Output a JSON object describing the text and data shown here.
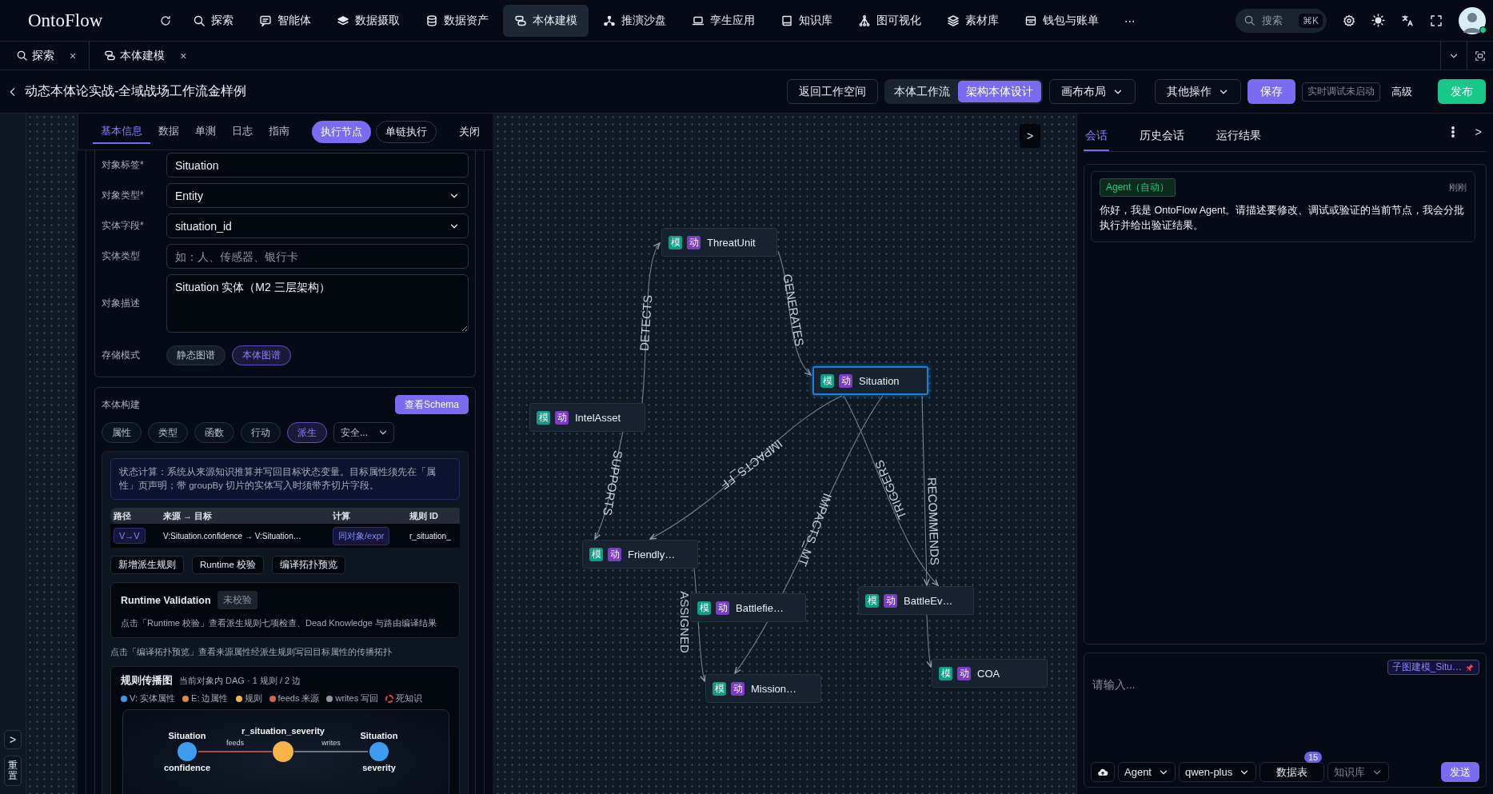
{
  "top_nav": {
    "logo": "OntoFlow",
    "items": [
      {
        "label": "探索",
        "selected": false
      },
      {
        "label": "智能体",
        "selected": false
      },
      {
        "label": "数据摄取",
        "selected": false
      },
      {
        "label": "数据资产",
        "selected": false
      },
      {
        "label": "本体建模",
        "selected": true
      },
      {
        "label": "推演沙盘",
        "selected": false
      },
      {
        "label": "孪生应用",
        "selected": false
      },
      {
        "label": "知识库",
        "selected": false
      },
      {
        "label": "图可视化",
        "selected": false
      },
      {
        "label": "素材库",
        "selected": false
      },
      {
        "label": "钱包与账单",
        "selected": false
      }
    ],
    "more": "⋯",
    "search": {
      "placeholder": "搜索",
      "shortcut": "⌘K"
    }
  },
  "page_tabs": [
    {
      "label": "探索",
      "close": "×"
    },
    {
      "label": "本体建模",
      "close": "×"
    }
  ],
  "header": {
    "title": "动态本体论实战-全域战场工作流金样例",
    "return_button": "返回工作空间",
    "mode_switch": [
      {
        "label": "本体工作流",
        "selected": false
      },
      {
        "label": "架构本体设计",
        "selected": true
      }
    ],
    "layout_menu": "画布布局",
    "more_menu": "其他操作",
    "save": "保存",
    "debug_status": "实时调试未启动",
    "advanced": "高级",
    "publish": "发布"
  },
  "side_strip": {
    "expand": ">",
    "reset": "重置"
  },
  "node_panel": {
    "tabs": [
      {
        "label": "基本信息",
        "selected": true
      },
      {
        "label": "数据",
        "selected": false
      },
      {
        "label": "单测",
        "selected": false
      },
      {
        "label": "日志",
        "selected": false
      },
      {
        "label": "指南",
        "selected": false
      }
    ],
    "run_node": "执行节点",
    "run_chain": "单链执行",
    "close": "关闭",
    "fields": [
      {
        "label": "对象标签*",
        "kind": "input",
        "value": "Situation"
      },
      {
        "label": "对象类型*",
        "kind": "select",
        "value": "Entity"
      },
      {
        "label": "实体字段*",
        "kind": "select",
        "value": "situation_id"
      },
      {
        "label": "实体类型",
        "kind": "input",
        "placeholder": "如：人、传感器、银行卡"
      },
      {
        "label": "对象描述",
        "kind": "textarea",
        "value": "Situation 实体（M2 三层架构）"
      }
    ],
    "storage": {
      "label": "存储模式",
      "options": [
        {
          "label": "静态图谱",
          "selected": false
        },
        {
          "label": "本体图谱",
          "selected": true
        }
      ]
    },
    "build": {
      "title": "本体构建",
      "schema_button": "查看Schema",
      "chips": [
        {
          "label": "属性",
          "selected": false
        },
        {
          "label": "类型",
          "selected": false
        },
        {
          "label": "函数",
          "selected": false
        },
        {
          "label": "行动",
          "selected": false
        },
        {
          "label": "派生",
          "selected": true
        }
      ],
      "chip_select": "安全...",
      "info": "状态计算：系统从来源知识推算并写回目标状态变量。目标属性须先在「属性」页声明；带 groupBy 切片的实体写入时须带齐切片字段。",
      "table": {
        "columns": [
          "路径",
          "来源 → 目标",
          "计算",
          "规则 ID"
        ],
        "rows": [
          {
            "path": "V→V",
            "mapping": "V:Situation.confidence → V:Situation…",
            "compute": "同对象/expr",
            "rule_id": "r_situation_"
          }
        ]
      },
      "actions": [
        "新增派生规则",
        "Runtime 校验",
        "编译拓扑预览"
      ],
      "validation": {
        "title": "Runtime Validation",
        "status": "未校验",
        "text": "点击「Runtime 校验」查看派生规则七项检查、Dead Knowledge 与路由编译结果"
      },
      "hint": "点击「编译拓扑预览」查看来源属性经派生规则写回目标属性的传播拓扑",
      "propagation": {
        "title": "规则传播图",
        "subtitle": "当前对象内 DAG · 1 规则 / 2 边",
        "legend": [
          {
            "label": "V: 实体属性",
            "kind": "dot",
            "color": "#3b9cf0"
          },
          {
            "label": "E: 边属性",
            "kind": "dot",
            "color": "#d98a4e"
          },
          {
            "label": "规则",
            "kind": "dot",
            "color": "#f5b445"
          },
          {
            "label": "feeds 来源",
            "kind": "dot",
            "color": "#d8674f"
          },
          {
            "label": "writes 写回",
            "kind": "dot",
            "color": "#8d95a8"
          },
          {
            "label": "死知识",
            "kind": "ring",
            "color": "#e04848"
          }
        ],
        "nodes": [
          {
            "kind": "attribute",
            "top": "Situation",
            "bottom": "confidence"
          },
          {
            "kind": "rule",
            "label": "r_situation_severity"
          },
          {
            "kind": "attribute",
            "top": "Situation",
            "bottom": "severity"
          }
        ],
        "edges": [
          {
            "kind": "feeds",
            "label": "feeds"
          },
          {
            "kind": "writes",
            "label": "writes"
          }
        ]
      }
    }
  },
  "canvas": {
    "toggle": ">",
    "nodes": [
      {
        "label": "ThreatUnit",
        "selected": false,
        "badges": [
          "模",
          "动"
        ]
      },
      {
        "label": "Situation",
        "selected": true,
        "badges": [
          "模",
          "动"
        ]
      },
      {
        "label": "IntelAsset",
        "selected": false,
        "badges": [
          "模",
          "动"
        ]
      },
      {
        "label": "Friendly…",
        "selected": false,
        "badges": [
          "模",
          "动"
        ]
      },
      {
        "label": "Battlefie…",
        "selected": false,
        "badges": [
          "模",
          "动"
        ]
      },
      {
        "label": "BattleEv…",
        "selected": false,
        "badges": [
          "模",
          "动"
        ]
      },
      {
        "label": "COA",
        "selected": false,
        "badges": [
          "模",
          "动"
        ]
      },
      {
        "label": "Mission…",
        "selected": false,
        "badges": [
          "模",
          "动"
        ]
      }
    ],
    "edges": [
      {
        "kind": "labeled",
        "label": "DETECTS"
      },
      {
        "kind": "labeled",
        "label": "GENERATES"
      },
      {
        "kind": "labeled",
        "label": "SUPPORTS"
      },
      {
        "kind": "labeled",
        "label": "IMPACTS_FF"
      },
      {
        "kind": "labeled",
        "label": "IMPACTS_MT"
      },
      {
        "kind": "labeled",
        "label": "TRIGGERS"
      },
      {
        "kind": "labeled",
        "label": "RECOMMENDS"
      },
      {
        "kind": "labeled",
        "label": "ASSIGNED"
      },
      {
        "kind": "plain"
      }
    ]
  },
  "chat": {
    "tabs": [
      {
        "label": "会话",
        "selected": true
      },
      {
        "label": "历史会话",
        "selected": false
      },
      {
        "label": "运行结果",
        "selected": false
      }
    ],
    "collapse": ">",
    "messages": [
      {
        "sender": "Agent（自动）",
        "time": "刚刚",
        "text": "你好，我是 OntoFlow Agent。请描述要修改、调试或验证的当前节点，我会分批执行并给出验证结果。"
      }
    ],
    "composer": {
      "context_chip": "子图建模_Situ…",
      "placeholder": "请输入...",
      "mode": "Agent",
      "model": "qwen-plus",
      "table_button": "数据表",
      "table_count": "15",
      "knowledge": "知识库",
      "knowledge_disabled": true,
      "send": "发送"
    }
  }
}
